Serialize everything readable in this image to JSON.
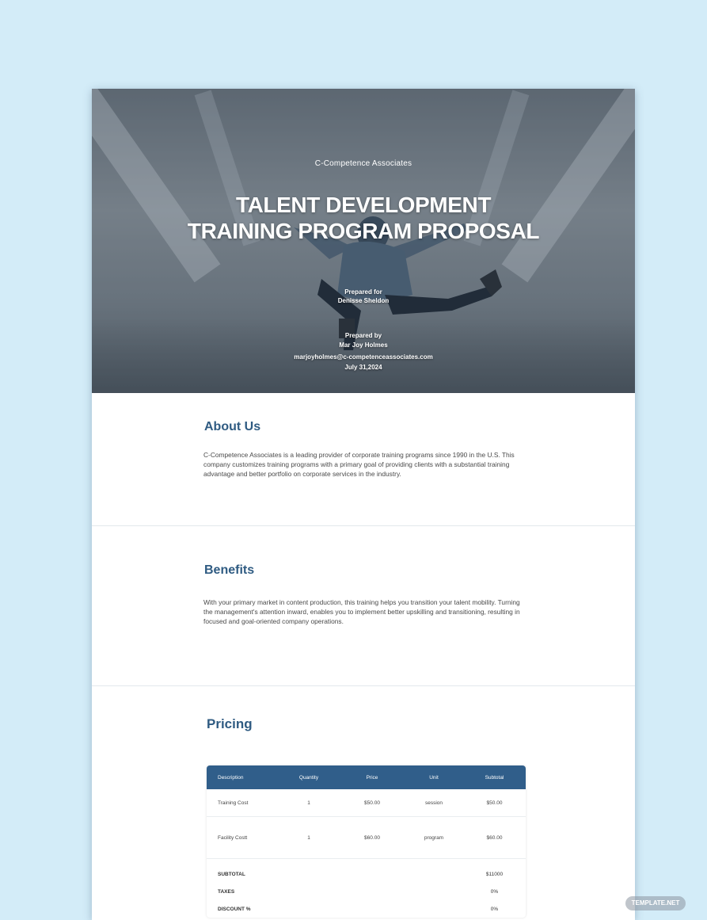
{
  "hero": {
    "company": "C-Competence Associates",
    "title_line1": "TALENT DEVELOPMENT",
    "title_line2": "TRAINING PROGRAM PROPOSAL",
    "prepared_for_label": "Prepared for",
    "prepared_for_name": "Denisse Sheldon",
    "prepared_by_label": "Prepared by",
    "prepared_by_name": "Mar Joy Holmes",
    "email": "marjoyholmes@c-competenceassociates.com",
    "date": "July 31,2024"
  },
  "about": {
    "heading": "About Us",
    "body": "C-Competence Associates is a leading provider of corporate training programs since 1990 in the U.S.  This company customizes training programs with a primary goal of providing clients with a substantial training advantage and better portfolio on corporate services in the industry."
  },
  "benefits": {
    "heading": "Benefits",
    "body": "With your primary market in content production, this training helps you transition your talent mobility. Turning the management's attention inward, enables you to implement better upskilling and transitioning, resulting in  focused and goal-oriented company operations."
  },
  "pricing": {
    "heading": "Pricing",
    "columns": [
      "Description",
      "Quantity",
      "Price",
      "Unit",
      "Subtotal"
    ],
    "rows": [
      {
        "description": "Training Cost",
        "quantity": "1",
        "price": "$50.00",
        "unit": "session",
        "subtotal": "$50.00"
      },
      {
        "description": "Facility Costt",
        "quantity": "1",
        "price": "$60.00",
        "unit": "program",
        "subtotal": "$60.00"
      }
    ],
    "summary": [
      {
        "label": "SUBTOTAL",
        "value": "$11000"
      },
      {
        "label": "TAXES",
        "value": "0%"
      },
      {
        "label": "DISCOUNT %",
        "value": "0%"
      }
    ]
  },
  "watermark": "TEMPLATE.NET"
}
